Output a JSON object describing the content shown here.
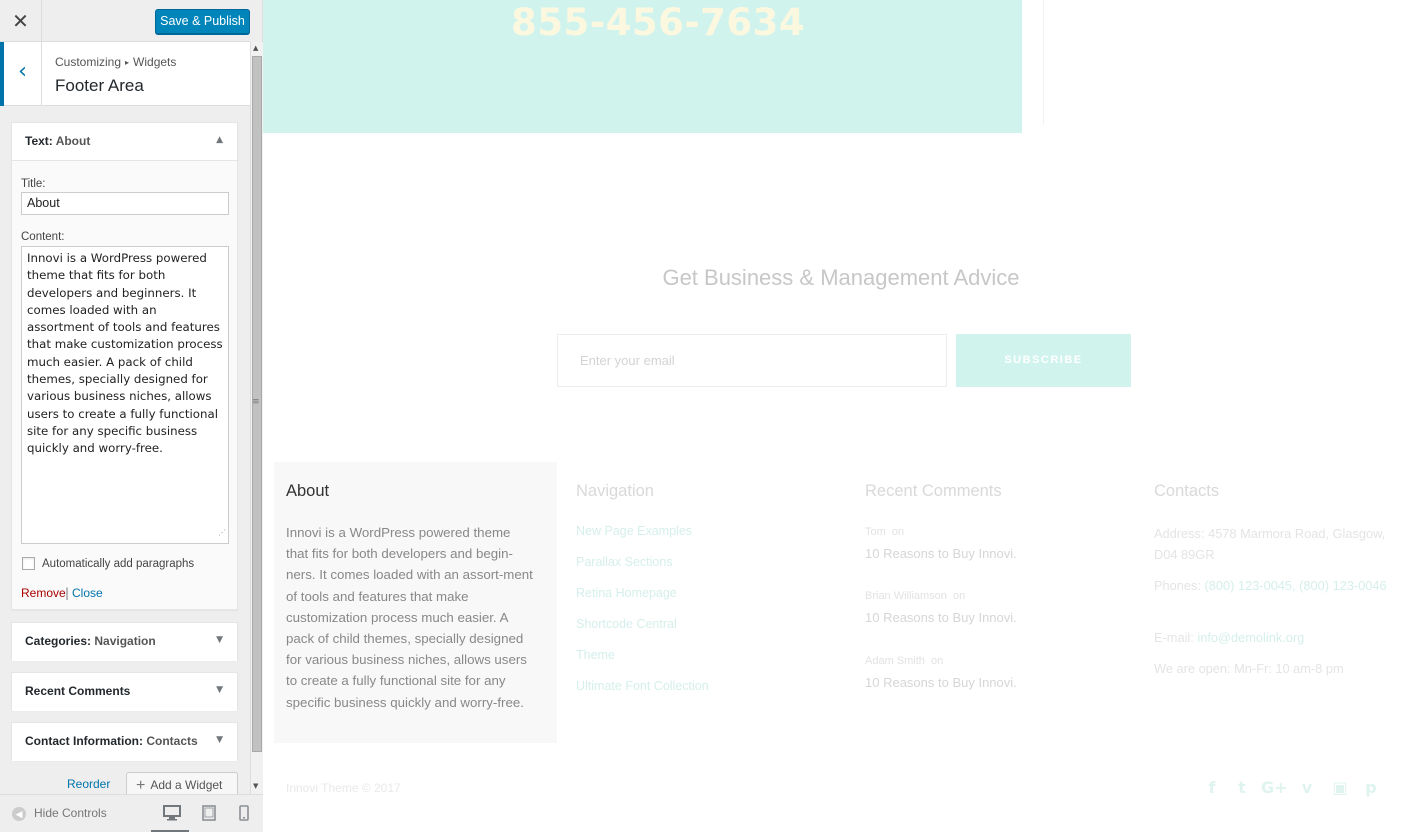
{
  "customizer": {
    "close_icon": "close-icon",
    "save_label": "Save & Publish",
    "breadcrumb": {
      "root": "Customizing",
      "separator": "▸",
      "current": "Widgets"
    },
    "section_title": "Footer Area",
    "expanded_widget": {
      "type": "Text",
      "instance": "About",
      "title_label": "Title:",
      "title_value": "About",
      "content_label": "Content:",
      "content_value": "Innovi is a WordPress powered theme that fits for both developers and beginners. It comes loaded with an assortment of tools and features that make customization process much easier. A pack of child themes, specially designed for various business niches, allows users to create a fully functional site for any specific business quickly and worry-free.",
      "autop_label": "Automatically add paragraphs",
      "autop_checked": false,
      "remove_label": "Remove",
      "separator": "|",
      "close_label": "Close"
    },
    "widgets": [
      {
        "type": "Categories",
        "instance": "Navigation"
      },
      {
        "type": "Recent Comments",
        "instance": ""
      },
      {
        "type": "Contact Information",
        "instance": "Contacts"
      }
    ],
    "reorder_label": "Reorder",
    "add_widget_label": "Add a Widget",
    "hide_controls_label": "Hide Controls",
    "devices": [
      "desktop",
      "tablet",
      "mobile"
    ],
    "active_device": "desktop"
  },
  "preview": {
    "phone": "855-456-7634",
    "newsletter": {
      "title": "Get Business & Management Advice",
      "email_placeholder": "Enter your email",
      "subscribe_label": "SUBSCRIBE"
    },
    "footer": {
      "about": {
        "title": "About",
        "text": "Innovi is a WordPress powered theme that fits for both developers and begin-ners. It comes loaded with an assort-ment of tools and features that make customization process much easier. A pack of child themes, specially designed for various business niches, allows users to create a fully functional site for any specific business quickly and worry-free."
      },
      "navigation": {
        "title": "Navigation",
        "links": [
          "New Page Examples",
          "Parallax Sections",
          "Retina Homepage",
          "Shortcode Central",
          "Theme",
          "Ultimate Font Collection"
        ]
      },
      "recent_comments": {
        "title": "Recent Comments",
        "items": [
          {
            "author": "Tom",
            "on": "on",
            "post": "10 Reasons to Buy Innovi."
          },
          {
            "author": "Brian Williamson",
            "on": "on",
            "post": "10 Reasons to Buy Innovi."
          },
          {
            "author": "Adam Smith",
            "on": "on",
            "post": "10 Reasons to Buy Innovi."
          }
        ]
      },
      "contacts": {
        "title": "Contacts",
        "address_label": "Address:",
        "address": "4578 Marmora Road, Glasgow, D04 89GR",
        "phones_label": "Phones:",
        "phones": "(800) 123-0045, (800) 123-0046",
        "email_label": "E-mail:",
        "email": "info@demolink.org",
        "hours": "We are open: Mn-Fr: 10 am-8 pm"
      },
      "copyright": "Innovi Theme © 2017",
      "socials": [
        "facebook-icon",
        "twitter-icon",
        "google-plus-icon",
        "vimeo-icon",
        "youtube-icon",
        "pinterest-icon"
      ]
    },
    "colors": {
      "accent": "#d0f3ee",
      "wp_blue": "#0085ba",
      "remove_red": "#aa0000"
    }
  }
}
